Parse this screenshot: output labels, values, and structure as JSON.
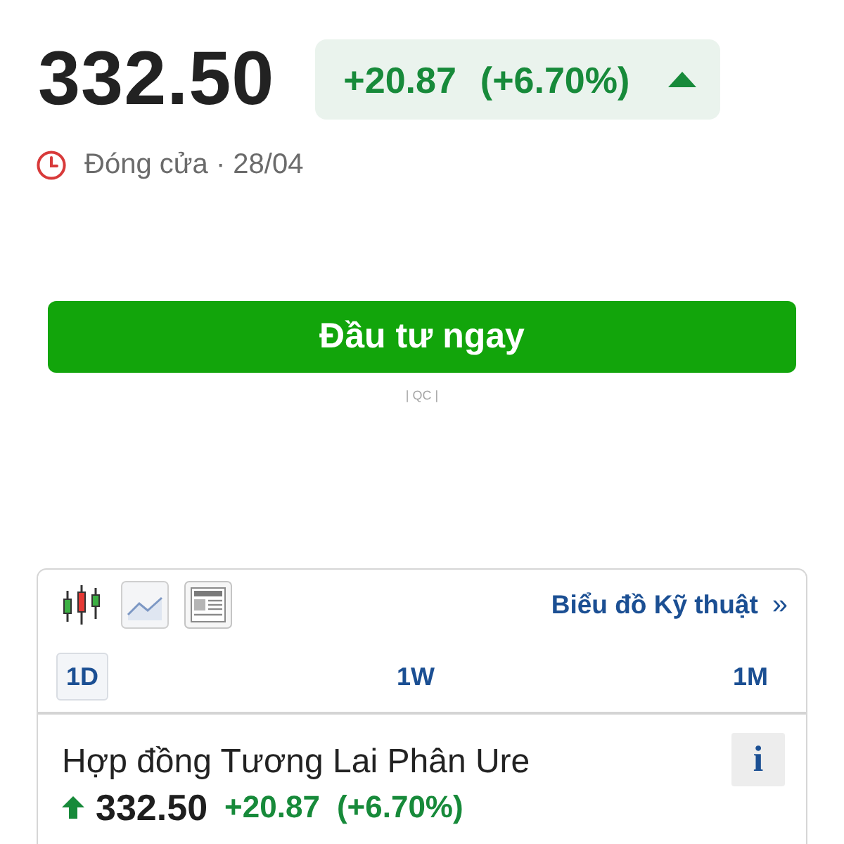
{
  "quote": {
    "price": "332.50",
    "change": "+20.87",
    "change_percent": "(+6.70%)",
    "rising": true
  },
  "status": {
    "text": "Đóng cửa · 28/04"
  },
  "cta_button": {
    "label": "Đầu tư ngay"
  },
  "ad_label": "| QC |",
  "widget": {
    "chart_tools": [
      {
        "kind": "candlestick"
      },
      {
        "kind": "line"
      },
      {
        "kind": "news"
      }
    ],
    "technical_link": {
      "label": "Biểu đồ Kỹ thuật",
      "arrow": "»"
    },
    "timeframes": [
      {
        "label": "1D",
        "selected": true
      },
      {
        "label": "1W",
        "selected": false
      },
      {
        "label": "1M",
        "selected": false
      }
    ],
    "instrument": {
      "name": "Hợp đồng Tương Lai Phân Ure",
      "info": "i",
      "price": "332.50",
      "change": "+20.87",
      "change_percent": "(+6.70%)",
      "rising": true
    }
  }
}
